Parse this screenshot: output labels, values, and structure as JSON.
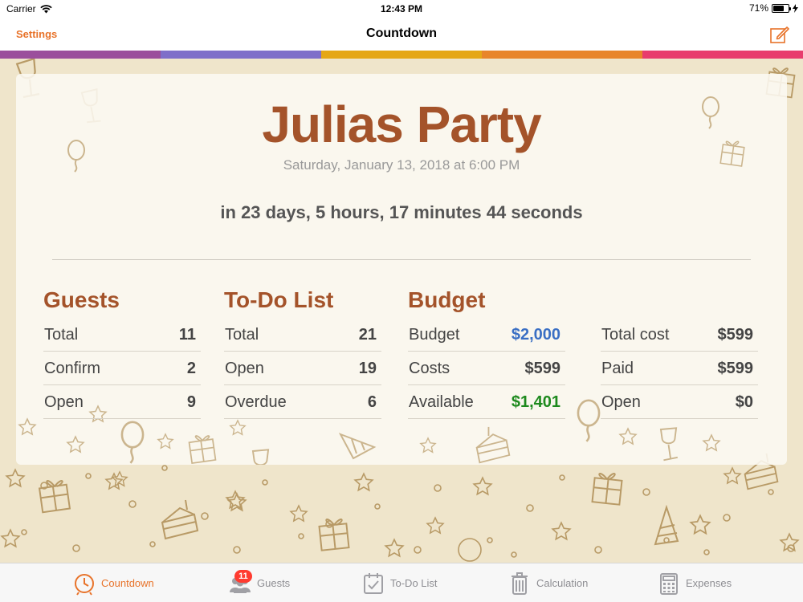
{
  "status_bar": {
    "carrier": "Carrier",
    "time": "12:43 PM",
    "battery": "71%"
  },
  "nav": {
    "left_button": "Settings",
    "title": "Countdown",
    "right_icon": "compose-icon"
  },
  "colors": {
    "accent": "#e8732a",
    "title_brown": "#a4532a",
    "strip": [
      "#9b4f9c",
      "#7f6fc9",
      "#e5a716",
      "#e8852a",
      "#e83c6d"
    ],
    "budget_blue": "#3a6fc4",
    "available_green": "#1e8a1e"
  },
  "event": {
    "title": "Julias Party",
    "date": "Saturday, January 13, 2018 at 6:00 PM",
    "countdown": "in 23 days, 5 hours, 17 minutes 44 seconds"
  },
  "guests": {
    "heading": "Guests",
    "rows": [
      {
        "label": "Total",
        "value": "11"
      },
      {
        "label": "Confirm",
        "value": "2"
      },
      {
        "label": "Open",
        "value": "9"
      }
    ]
  },
  "todo": {
    "heading": "To-Do List",
    "rows": [
      {
        "label": "Total",
        "value": "21"
      },
      {
        "label": "Open",
        "value": "19"
      },
      {
        "label": "Overdue",
        "value": "6"
      }
    ]
  },
  "budget": {
    "heading": "Budget",
    "rows": [
      {
        "label": "Budget",
        "value": "$2,000"
      },
      {
        "label": "Costs",
        "value": "$599"
      },
      {
        "label": "Available",
        "value": "$1,401"
      }
    ],
    "rows_right": [
      {
        "label": "Total cost",
        "value": "$599"
      },
      {
        "label": "Paid",
        "value": "$599"
      },
      {
        "label": "Open",
        "value": "$0"
      }
    ]
  },
  "tabs": [
    {
      "label": "Countdown",
      "icon": "clock-icon",
      "active": true
    },
    {
      "label": "Guests",
      "icon": "people-icon",
      "badge": "11"
    },
    {
      "label": "To-Do List",
      "icon": "checklist-icon"
    },
    {
      "label": "Calculation",
      "icon": "trash-can-icon"
    },
    {
      "label": "Expenses",
      "icon": "calculator-icon"
    }
  ]
}
